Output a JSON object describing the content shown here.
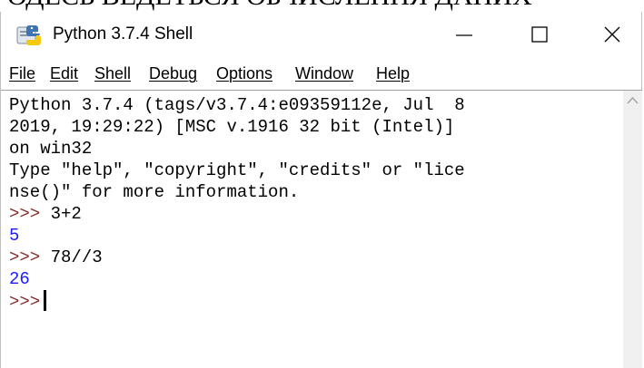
{
  "background": {
    "text": "ОДЕСЬ ВЕДЕТЬСЯ ОБЧИСЛЕННЯ ДАНИХ"
  },
  "window": {
    "title": "Python 3.7.4 Shell",
    "icons": {
      "app": "python-idle-icon",
      "minimize": "minimize-icon",
      "maximize": "maximize-icon",
      "close": "close-icon",
      "scroll_up": "chevron-up-icon"
    }
  },
  "menu": {
    "items": [
      {
        "label": "File"
      },
      {
        "label": "Edit"
      },
      {
        "label": "Shell"
      },
      {
        "label": "Debug"
      },
      {
        "label": "Options"
      },
      {
        "label": "Window"
      },
      {
        "label": "Help"
      }
    ]
  },
  "shell": {
    "banner": [
      "Python 3.7.4 (tags/v3.7.4:e09359112e, Jul  8",
      "2019, 19:29:22) [MSC v.1916 32 bit (Intel)]",
      "on win32",
      "Type \"help\", \"copyright\", \"credits\" or \"lice",
      "nse()\" for more information."
    ],
    "prompt": ">>>",
    "entries": [
      {
        "input": "3+2",
        "output": "5"
      },
      {
        "input": "78//3",
        "output": "26"
      }
    ]
  },
  "colors": {
    "prompt": "#8a2b2b",
    "result": "#1a1aff",
    "text": "#000000"
  }
}
